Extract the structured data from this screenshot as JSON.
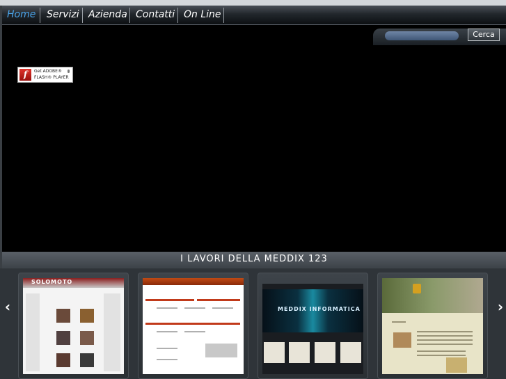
{
  "nav": {
    "items": [
      {
        "label": "Home",
        "active": true
      },
      {
        "label": "Servizi",
        "active": false
      },
      {
        "label": "Azienda",
        "active": false
      },
      {
        "label": "Contatti",
        "active": false
      },
      {
        "label": "On Line",
        "active": false
      }
    ]
  },
  "search": {
    "button_label": "Cerca"
  },
  "flash_badge": {
    "line1": "Get ADOBE®",
    "line2": "FLASH® PLAYER",
    "icon": "flash-logo-icon"
  },
  "gallery": {
    "title": "I LAVORI DELLA MEDDIX 123",
    "prev_icon": "chevron-left-icon",
    "next_icon": "chevron-right-icon",
    "thumbnails": [
      {
        "label": "SOLOMOTO"
      },
      {
        "label": ""
      },
      {
        "label": "MEDDIX INFORMATICA"
      },
      {
        "label": ""
      }
    ]
  },
  "colors": {
    "active_nav": "#4aa3e8",
    "stage": "#000000",
    "bar": "#3c4248"
  }
}
